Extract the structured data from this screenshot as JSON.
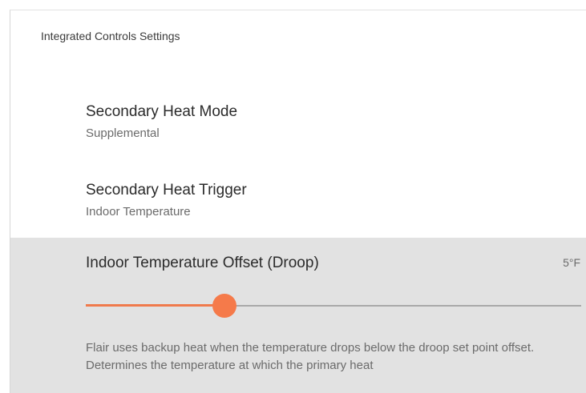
{
  "panel": {
    "title": "Integrated Controls Settings"
  },
  "secondary_heat_mode": {
    "label": "Secondary Heat Mode",
    "value": "Supplemental"
  },
  "secondary_heat_trigger": {
    "label": "Secondary Heat Trigger",
    "value": "Indoor Temperature"
  },
  "indoor_temperature_offset": {
    "label": "Indoor Temperature Offset (Droop)",
    "value_text": "5°F",
    "slider_fraction": 0.28,
    "description": "Flair uses backup heat when the temperature drops below the droop set point offset. Determines the temperature at which the primary heat"
  },
  "colors": {
    "accent": "#f57a4a",
    "active_row_bg": "#e2e2e2",
    "track": "#a9a9a9"
  }
}
